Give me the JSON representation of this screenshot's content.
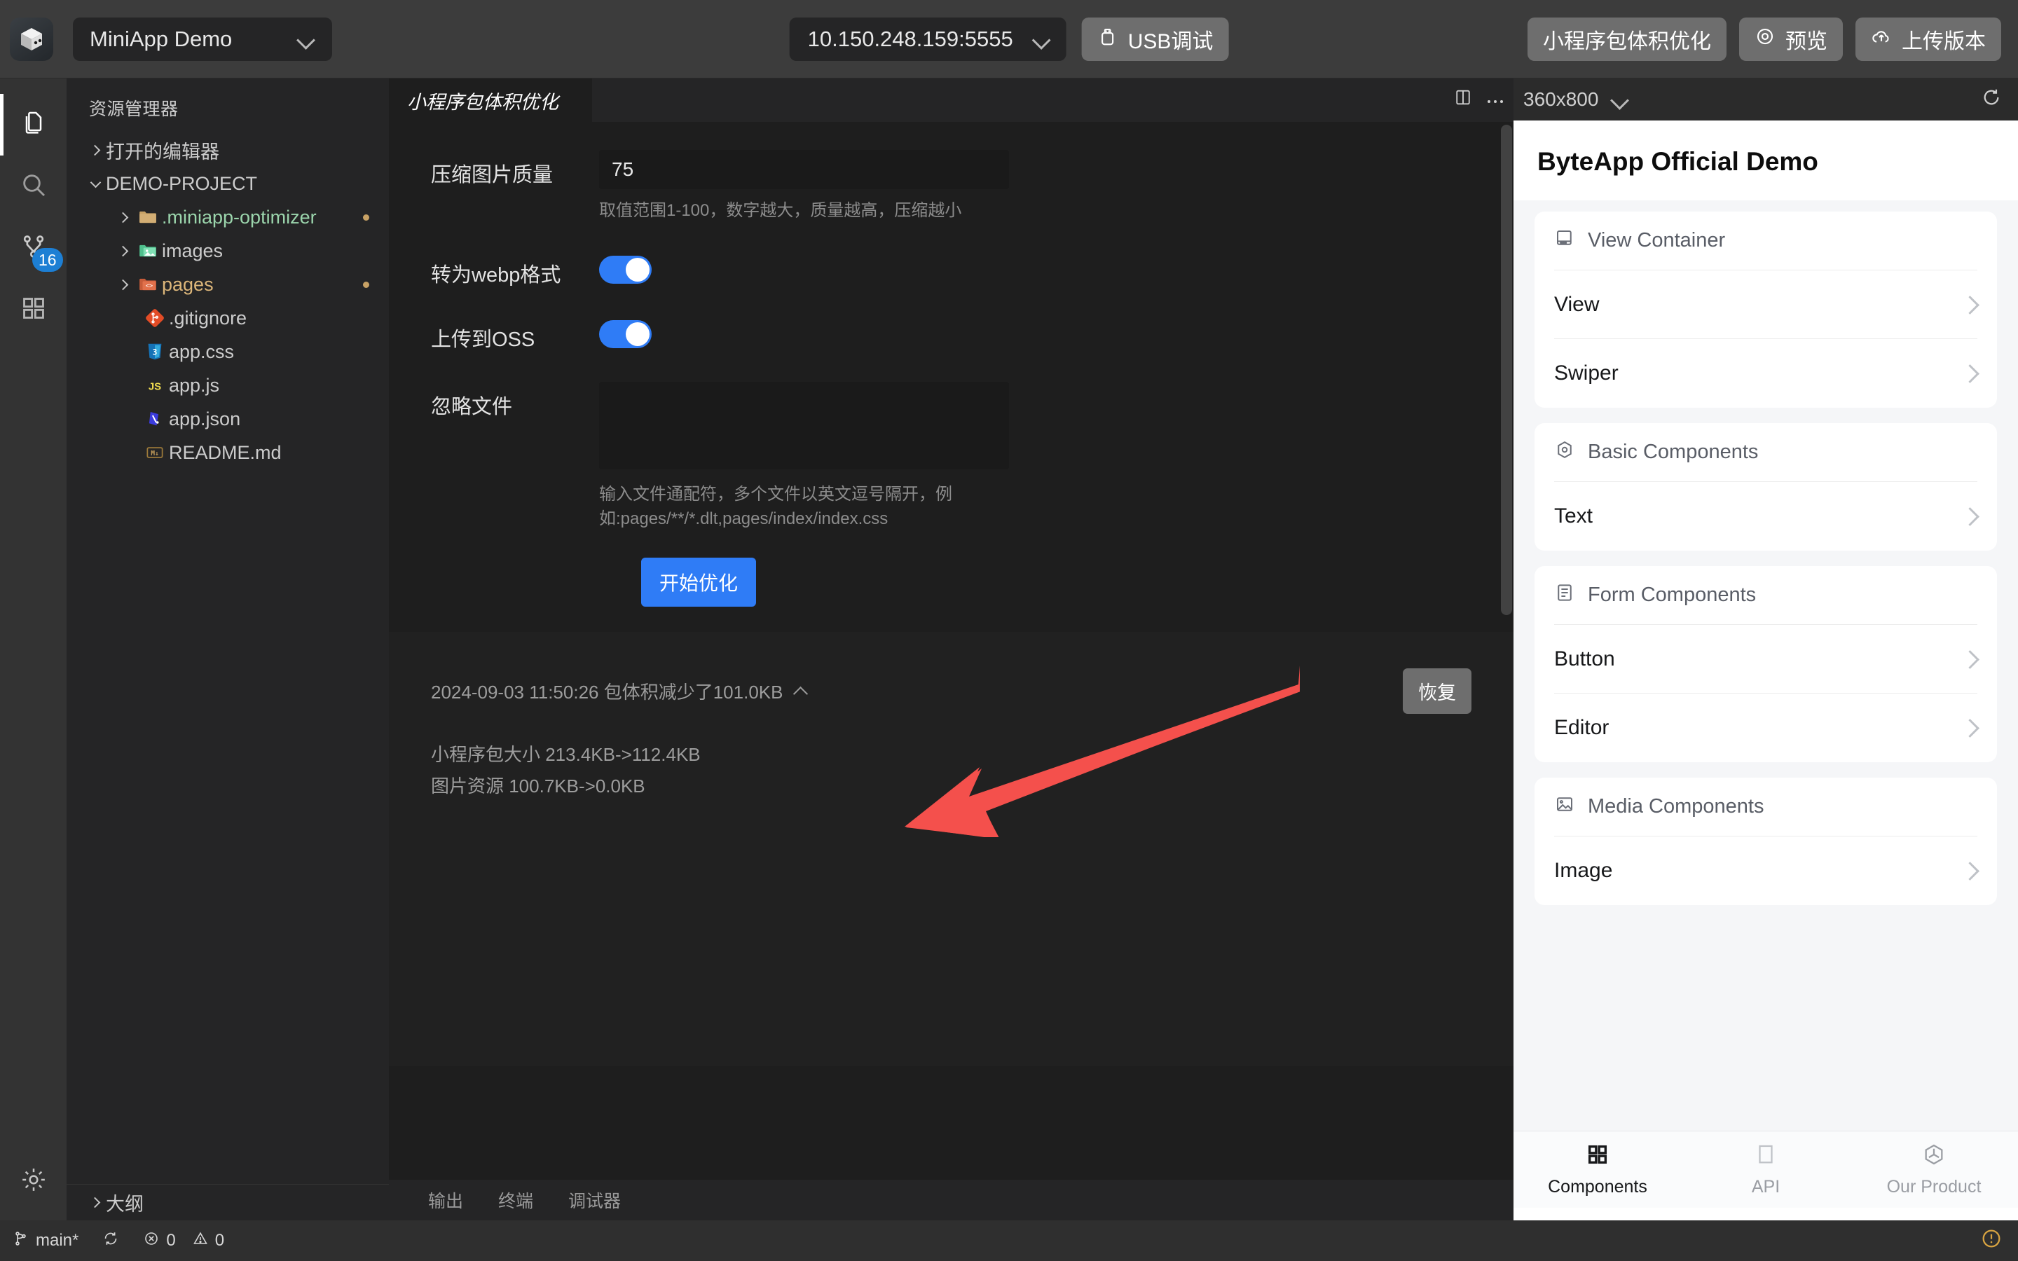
{
  "titlebar": {
    "logo_icon": "cube-logo-icon",
    "project_name": "MiniApp Demo",
    "device_address": "10.150.248.159:5555",
    "usb_debug_label": "USB调试",
    "optimize_label": "小程序包体积优化",
    "preview_label": "预览",
    "upload_label": "上传版本"
  },
  "activitybar": {
    "items": [
      {
        "name": "explorer",
        "icon": "files-icon",
        "badge": ""
      },
      {
        "name": "search",
        "icon": "search-icon",
        "badge": ""
      },
      {
        "name": "source-control",
        "icon": "source-control-icon",
        "badge": "16"
      },
      {
        "name": "extensions",
        "icon": "extensions-icon",
        "badge": ""
      }
    ],
    "settings_icon": "gear-icon"
  },
  "explorer": {
    "title": "资源管理器",
    "open_editors_label": "打开的编辑器",
    "project_label": "DEMO-PROJECT",
    "outline_label": "大纲",
    "files": [
      {
        "label": ".miniapp-optimizer",
        "type": "folder",
        "icon": "folder-icon",
        "color": "#9bd5ac",
        "expandable": true,
        "modified": true
      },
      {
        "label": "images",
        "type": "folder",
        "icon": "folder-images-icon",
        "color": "#cccccc",
        "expandable": true,
        "modified": false
      },
      {
        "label": "pages",
        "type": "folder",
        "icon": "folder-code-icon",
        "color": "#dcb67a",
        "expandable": true,
        "modified": true
      },
      {
        "label": ".gitignore",
        "type": "file",
        "icon": "git-icon",
        "color": "#cccccc",
        "expandable": false,
        "modified": false
      },
      {
        "label": "app.css",
        "type": "file",
        "icon": "css-icon",
        "color": "#cccccc",
        "expandable": false,
        "modified": false
      },
      {
        "label": "app.js",
        "type": "file",
        "icon": "js-icon",
        "color": "#cccccc",
        "expandable": false,
        "modified": false
      },
      {
        "label": "app.json",
        "type": "file",
        "icon": "json-icon",
        "color": "#cccccc",
        "expandable": false,
        "modified": false
      },
      {
        "label": "README.md",
        "type": "file",
        "icon": "markdown-icon",
        "color": "#cccccc",
        "expandable": false,
        "modified": false
      }
    ]
  },
  "editor": {
    "tab_label": "小程序包体积优化",
    "form": {
      "quality_label": "压缩图片质量",
      "quality_value": "75",
      "quality_hint": "取值范围1-100，数字越大，质量越高，压缩越小",
      "webp_label": "转为webp格式",
      "webp_on": true,
      "oss_label": "上传到OSS",
      "oss_on": true,
      "ignore_label": "忽略文件",
      "ignore_value": "",
      "ignore_placeholder": "",
      "ignore_hint": "输入文件通配符，多个文件以英文逗号隔开，例如:pages/**/*.dlt,pages/index/index.css",
      "start_button": "开始优化"
    },
    "result": {
      "timestamp_line": "2024-09-03 11:50:26 包体积减少了101.0KB",
      "collapse_icon": "caret-up-icon",
      "restore_button": "恢复",
      "lines": [
        "小程序包大小 213.4KB->112.4KB",
        "图片资源 100.7KB->0.0KB"
      ]
    }
  },
  "panelbar": {
    "tabs": [
      "输出",
      "终端",
      "调试器"
    ]
  },
  "preview": {
    "layout_icon": "split-layout-icon",
    "more_icon": "ellipsis-icon",
    "size": "360x800",
    "refresh_icon": "refresh-icon",
    "app_title": "ByteApp Official Demo",
    "sections": [
      {
        "header": "View Container",
        "header_icon": "view-container-icon",
        "rows": [
          "View",
          "Swiper"
        ]
      },
      {
        "header": "Basic Components",
        "header_icon": "basic-components-icon",
        "rows": [
          "Text"
        ]
      },
      {
        "header": "Form Components",
        "header_icon": "form-components-icon",
        "rows": [
          "Button",
          "Editor"
        ]
      },
      {
        "header": "Media Components",
        "header_icon": "media-components-icon",
        "rows": [
          "Image"
        ]
      }
    ],
    "tabbar": [
      {
        "label": "Components",
        "icon": "grid-icon",
        "active": true
      },
      {
        "label": "API",
        "icon": "square-icon",
        "active": false
      },
      {
        "label": "Our Product",
        "icon": "hexagon-icon",
        "active": false
      }
    ]
  },
  "statusbar": {
    "branch_icon": "git-branch-icon",
    "branch": "main*",
    "sync_icon": "sync-icon",
    "error_icon": "error-icon",
    "errors": "0",
    "warning_icon": "warning-icon",
    "warnings": "0",
    "notification_icon": "bell-warning-icon"
  },
  "annotation": {
    "arrow_color": "#F4504C",
    "arrow_icon": "red-arrow-icon"
  },
  "colors": {
    "accent_blue": "#2F7CF6",
    "badge_blue": "#1D7FD4",
    "titlebar_bg": "#3C3C3C",
    "sidebar_bg": "#252526",
    "editor_bg": "#1E1E1E",
    "statusbar_bg": "#2F2F2F"
  }
}
